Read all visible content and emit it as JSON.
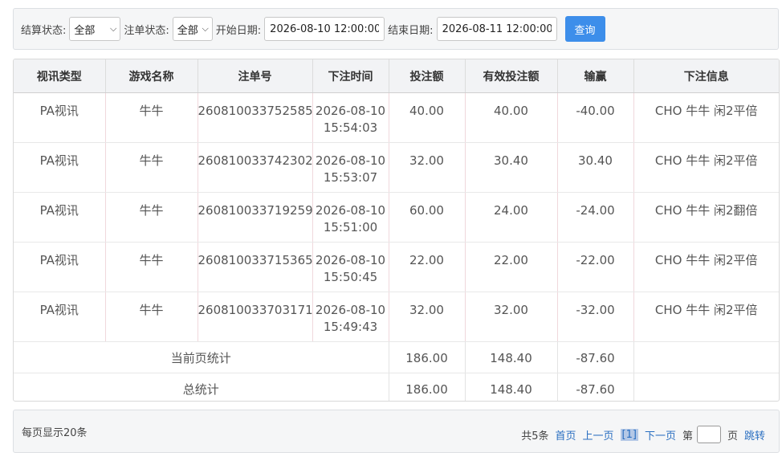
{
  "filters": {
    "settle_label": "结算状态:",
    "settle_value": "全部",
    "bet_label": "注单状态:",
    "bet_value": "全部",
    "start_label": "开始日期:",
    "start_value": "2026-08-10 12:00:00",
    "end_label": "结束日期:",
    "end_value": "2026-08-11 12:00:00",
    "query_label": "查询"
  },
  "table": {
    "headers": [
      "视讯类型",
      "游戏名称",
      "注单号",
      "下注时间",
      "投注额",
      "有效投注额",
      "输赢",
      "下注信息"
    ],
    "rows": [
      {
        "type": "PA视讯",
        "game": "牛牛",
        "bet_no": "260810033752585",
        "date": "2026-08-10",
        "time": "15:54:03",
        "amount": "40.00",
        "valid": "40.00",
        "win": "-40.00",
        "info": "CHO 牛牛 闲2平倍"
      },
      {
        "type": "PA视讯",
        "game": "牛牛",
        "bet_no": "260810033742302",
        "date": "2026-08-10",
        "time": "15:53:07",
        "amount": "32.00",
        "valid": "30.40",
        "win": "30.40",
        "info": "CHO 牛牛 闲2平倍"
      },
      {
        "type": "PA视讯",
        "game": "牛牛",
        "bet_no": "260810033719259",
        "date": "2026-08-10",
        "time": "15:51:00",
        "amount": "60.00",
        "valid": "24.00",
        "win": "-24.00",
        "info": "CHO 牛牛 闲2翻倍"
      },
      {
        "type": "PA视讯",
        "game": "牛牛",
        "bet_no": "260810033715365",
        "date": "2026-08-10",
        "time": "15:50:45",
        "amount": "22.00",
        "valid": "22.00",
        "win": "-22.00",
        "info": "CHO 牛牛 闲2平倍"
      },
      {
        "type": "PA视讯",
        "game": "牛牛",
        "bet_no": "260810033703171",
        "date": "2026-08-10",
        "time": "15:49:43",
        "amount": "32.00",
        "valid": "32.00",
        "win": "-32.00",
        "info": "CHO 牛牛 闲2平倍"
      }
    ],
    "page_total": {
      "label": "当前页统计",
      "amount": "186.00",
      "valid": "148.40",
      "win": "-87.60"
    },
    "grand_total": {
      "label": "总统计",
      "amount": "186.00",
      "valid": "148.40",
      "win": "-87.60"
    }
  },
  "pager": {
    "per_page": "每页显示20条",
    "total": "共5条",
    "first": "首页",
    "prev": "上一页",
    "current": "[1]",
    "next": "下一页",
    "page_prefix": "第",
    "page_suffix": "页",
    "jump": "跳转"
  }
}
